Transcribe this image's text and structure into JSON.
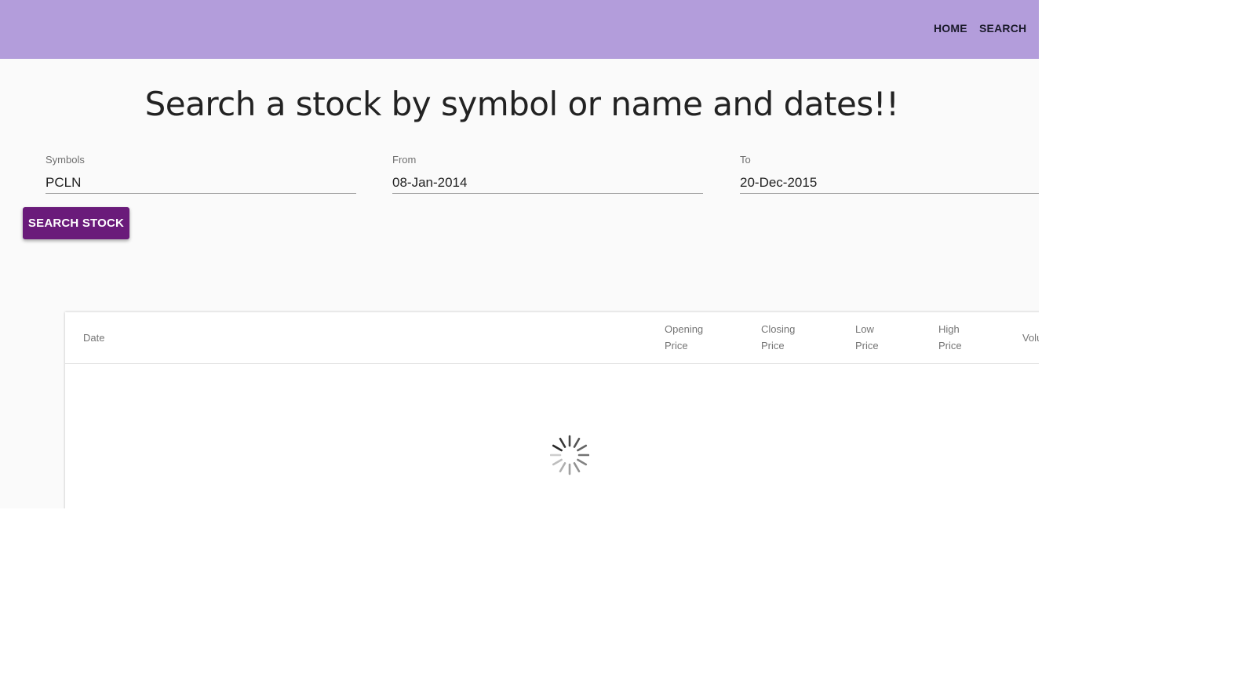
{
  "toolbar": {
    "nav": [
      {
        "label": "HOME"
      },
      {
        "label": "SEARCH"
      }
    ],
    "background_color": "#b39ddb"
  },
  "page": {
    "title": "Search a stock by symbol or name and dates!!"
  },
  "form": {
    "symbols": {
      "label": "Symbols",
      "value": "PCLN"
    },
    "from": {
      "label": "From",
      "value": "08-Jan-2014"
    },
    "to": {
      "label": "To",
      "value": "20-Dec-2015"
    },
    "search_button": {
      "label": "SEARCH STOCK",
      "color": "#6a1b7a"
    }
  },
  "table": {
    "columns": [
      {
        "line1": "Date",
        "line2": ""
      },
      {
        "line1": "Opening",
        "line2": "Price"
      },
      {
        "line1": "Closing",
        "line2": "Price"
      },
      {
        "line1": "Low",
        "line2": "Price"
      },
      {
        "line1": "High",
        "line2": "Price"
      },
      {
        "line1": "Volu",
        "line2": ""
      }
    ],
    "loading_icon": "spinner-icon"
  }
}
